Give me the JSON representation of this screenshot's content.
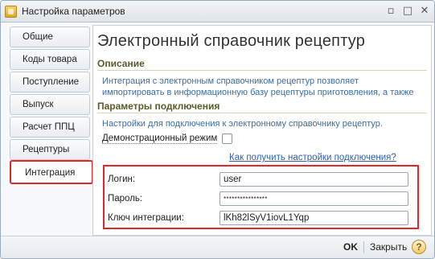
{
  "window": {
    "title": "Настройка параметров",
    "controls": {
      "minimize": "▫",
      "maximize": "□",
      "close": "✕"
    }
  },
  "sidebar": {
    "tabs": [
      {
        "label": "Общие"
      },
      {
        "label": "Коды товара"
      },
      {
        "label": "Поступление"
      },
      {
        "label": "Выпуск"
      },
      {
        "label": "Расчет ППЦ"
      },
      {
        "label": "Рецептуры"
      },
      {
        "label": "Интеграция"
      }
    ],
    "active_tab": "Интеграция"
  },
  "main": {
    "heading": "Электронный справочник рецептур",
    "description_title": "Описание",
    "description_text_1": "Интеграция с электронным справочником рецептур позволяет",
    "description_text_2": "импортировать в информационную базу рецептуры приготовления, а также",
    "connection_title": "Параметры подключения",
    "connection_text": "Настройки для подключения к электронному справочнику рецептур.",
    "demo_mode_label": "Демонстрационный режим",
    "demo_mode_checked": false,
    "help_link": "Как получить настройки подключения?",
    "fields": {
      "login_label": "Логин:",
      "login_value": "user",
      "password_label": "Пароль:",
      "password_value": "****************",
      "key_label": "Ключ интеграции:",
      "key_value": "lKh82lSyV1iovL1Yqp"
    }
  },
  "footer": {
    "ok_label": "OK",
    "close_label": "Закрыть",
    "help_label": "?"
  },
  "colors": {
    "highlight_border": "#e0282b",
    "section_title": "#5b5a2a",
    "link": "#2b5fb3",
    "description_text": "#3a6ea5"
  }
}
